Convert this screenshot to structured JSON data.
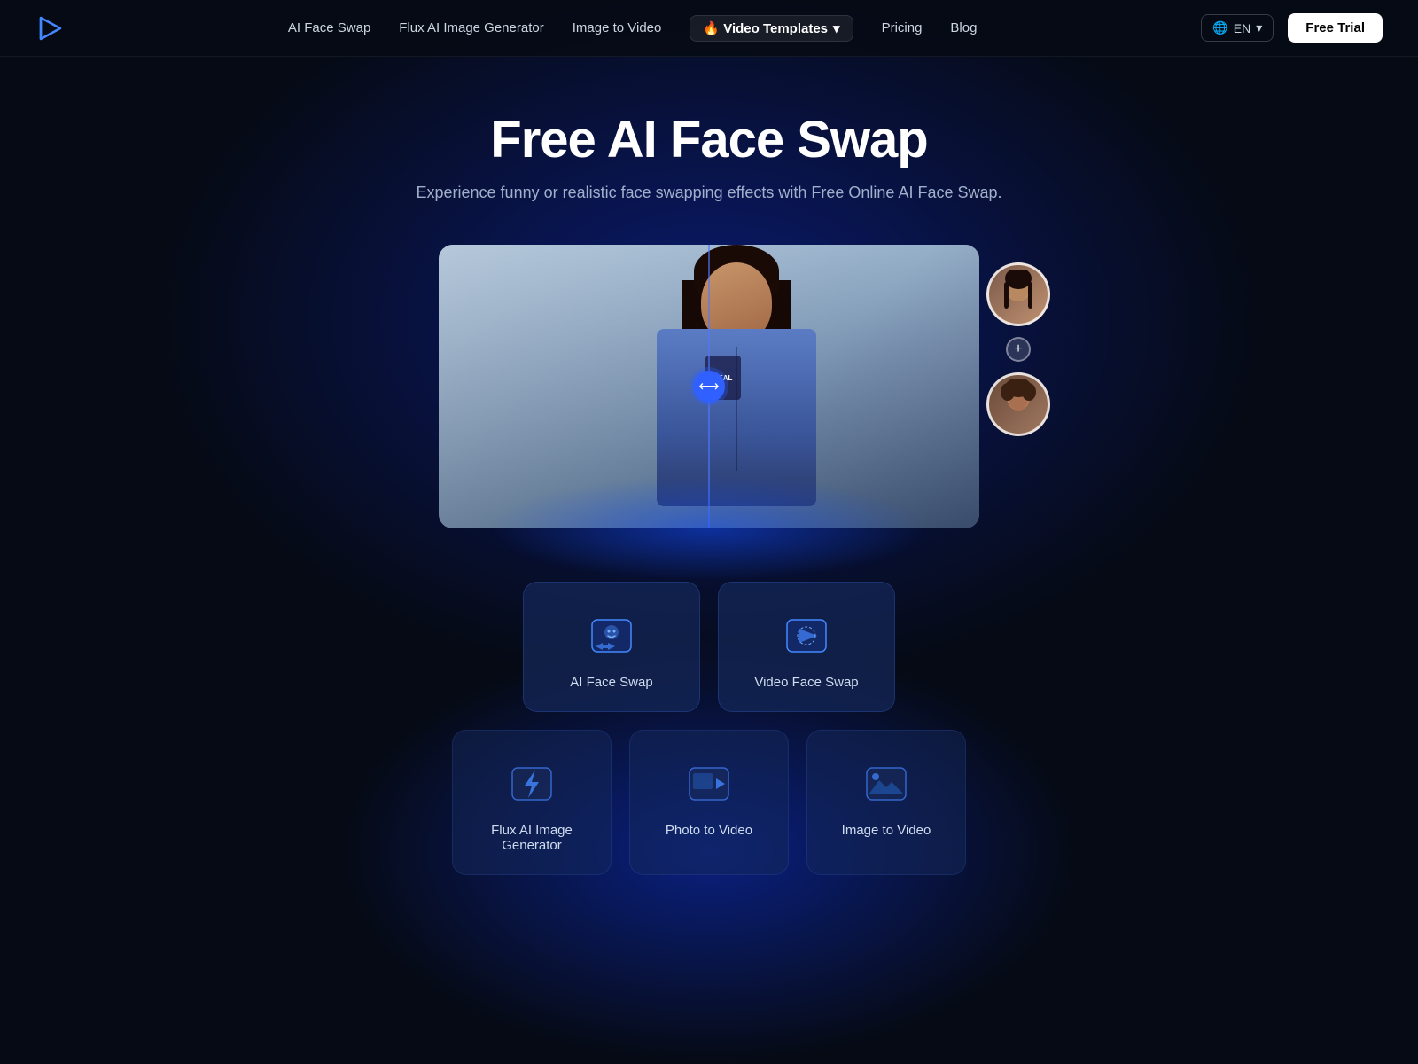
{
  "navbar": {
    "logo_alt": "Logo",
    "links": [
      {
        "label": "AI Face Swap",
        "id": "ai-face-swap",
        "active": false
      },
      {
        "label": "Flux AI Image Generator",
        "id": "flux-ai-image-generator",
        "active": false
      },
      {
        "label": "Image to Video",
        "id": "image-to-video",
        "active": false
      },
      {
        "label": "🔥 Video Templates",
        "id": "video-templates",
        "active": true,
        "has_dropdown": true
      },
      {
        "label": "Pricing",
        "id": "pricing",
        "active": false
      },
      {
        "label": "Blog",
        "id": "blog",
        "active": false
      }
    ],
    "lang_label": "EN",
    "free_trial_label": "Free Trial"
  },
  "hero": {
    "title": "Free AI Face Swap",
    "subtitle": "Experience funny or realistic face swapping effects with Free Online AI Face Swap.",
    "swap_arrow_symbol": "⟷"
  },
  "cards_main": [
    {
      "label": "AI Face Swap",
      "icon": "face-swap-icon"
    },
    {
      "label": "Video Face Swap",
      "icon": "video-face-swap-icon"
    }
  ],
  "cards_bottom": [
    {
      "label": "Flux AI Image Generator",
      "icon": "flux-icon"
    },
    {
      "label": "Photo to Video",
      "icon": "photo-video-icon"
    },
    {
      "label": "Image to Video",
      "icon": "image-video-icon"
    }
  ]
}
